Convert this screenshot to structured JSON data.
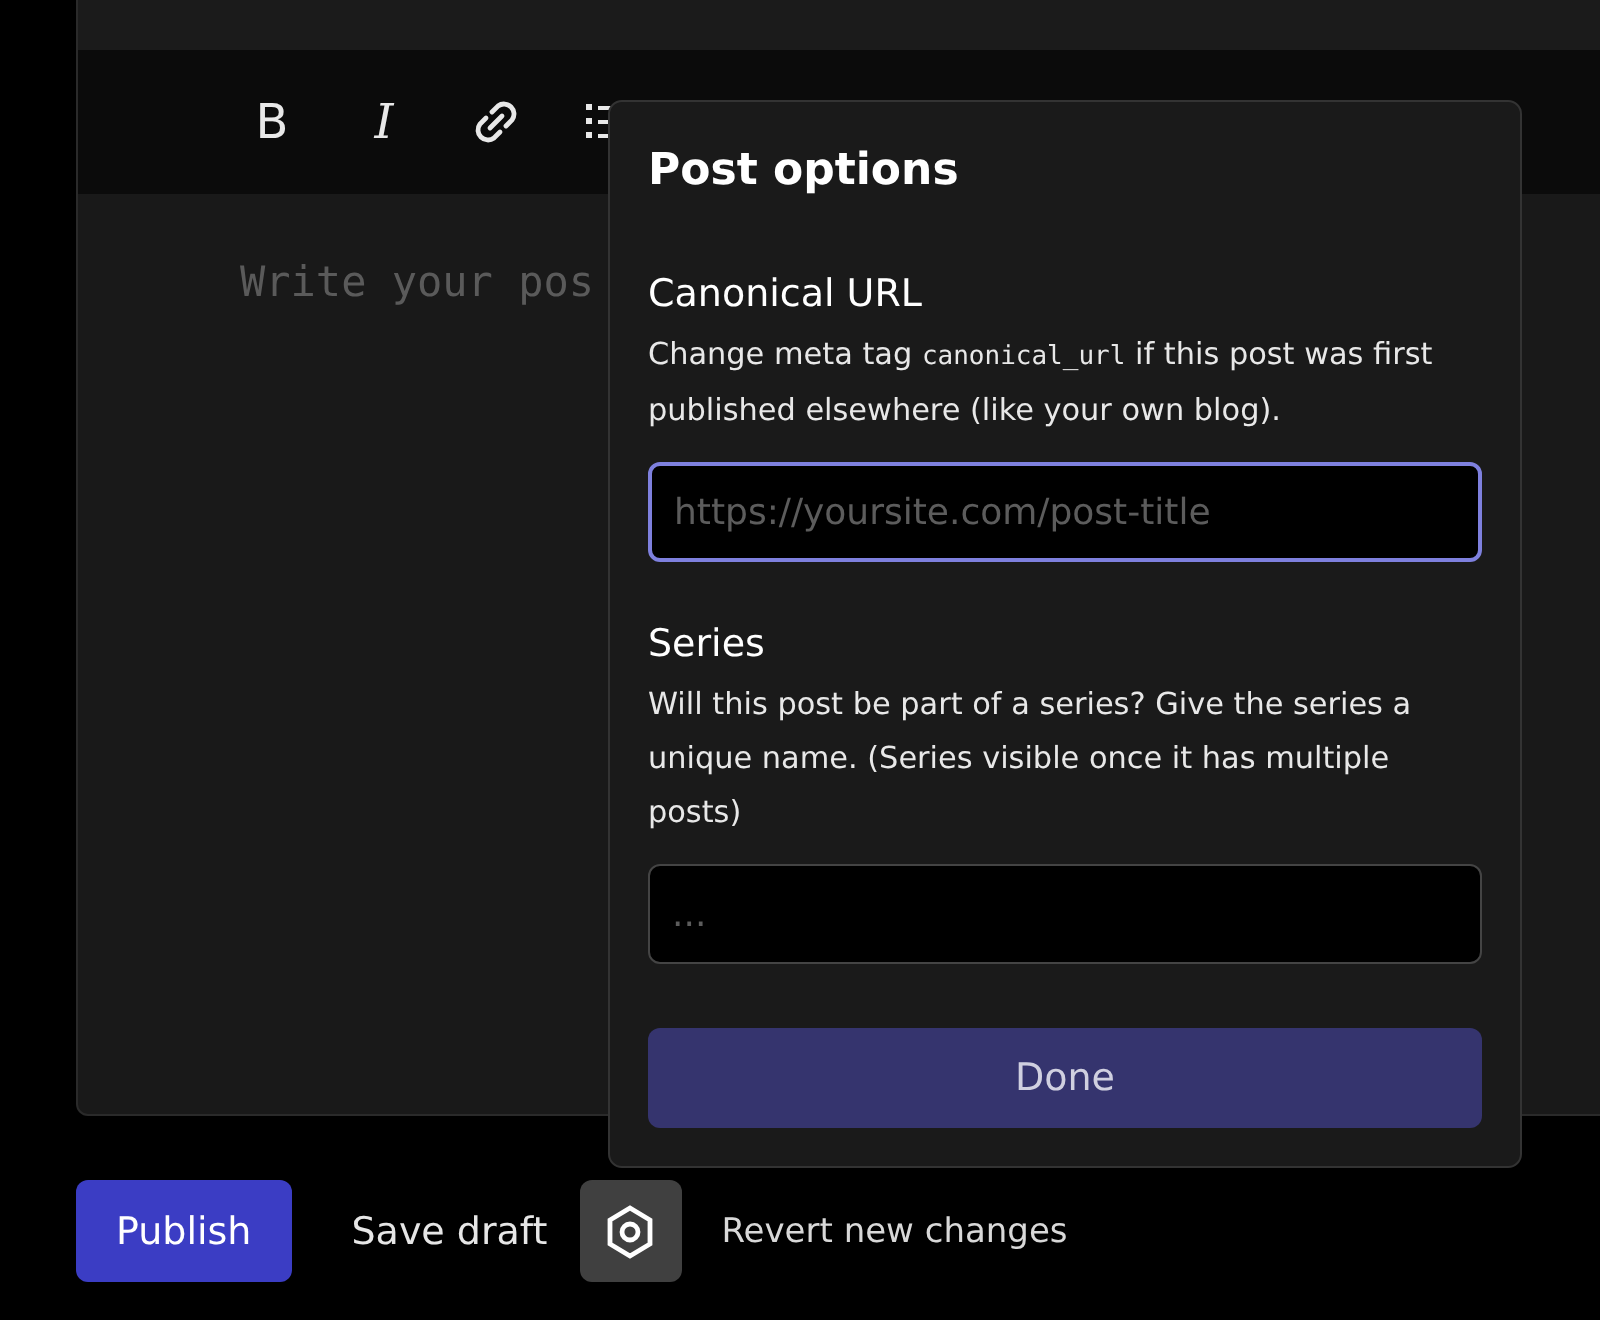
{
  "editor": {
    "toolbar": [
      {
        "kind": "bold",
        "label": "B"
      },
      {
        "kind": "italic",
        "label": "I"
      },
      {
        "kind": "link"
      },
      {
        "kind": "ordered-list"
      }
    ],
    "placeholder": "Write your pos"
  },
  "post_options": {
    "title": "Post options",
    "sections": [
      {
        "label": "Canonical URL",
        "description": {
          "before": "Change meta tag ",
          "code": "canonical_url",
          "after": " if this post was first published elsewhere (like your own blog)."
        },
        "placeholder": "https://yoursite.com/post-title",
        "focused": true
      },
      {
        "label": "Series",
        "description": {
          "before": "Will this post be part of a series? Give the series a unique name. (Series visible once it has multiple posts)"
        },
        "placeholder": "...",
        "focused": false
      }
    ],
    "done": "Done"
  },
  "actions": {
    "publish": "Publish",
    "save_draft": "Save draft",
    "revert": "Revert new changes"
  }
}
